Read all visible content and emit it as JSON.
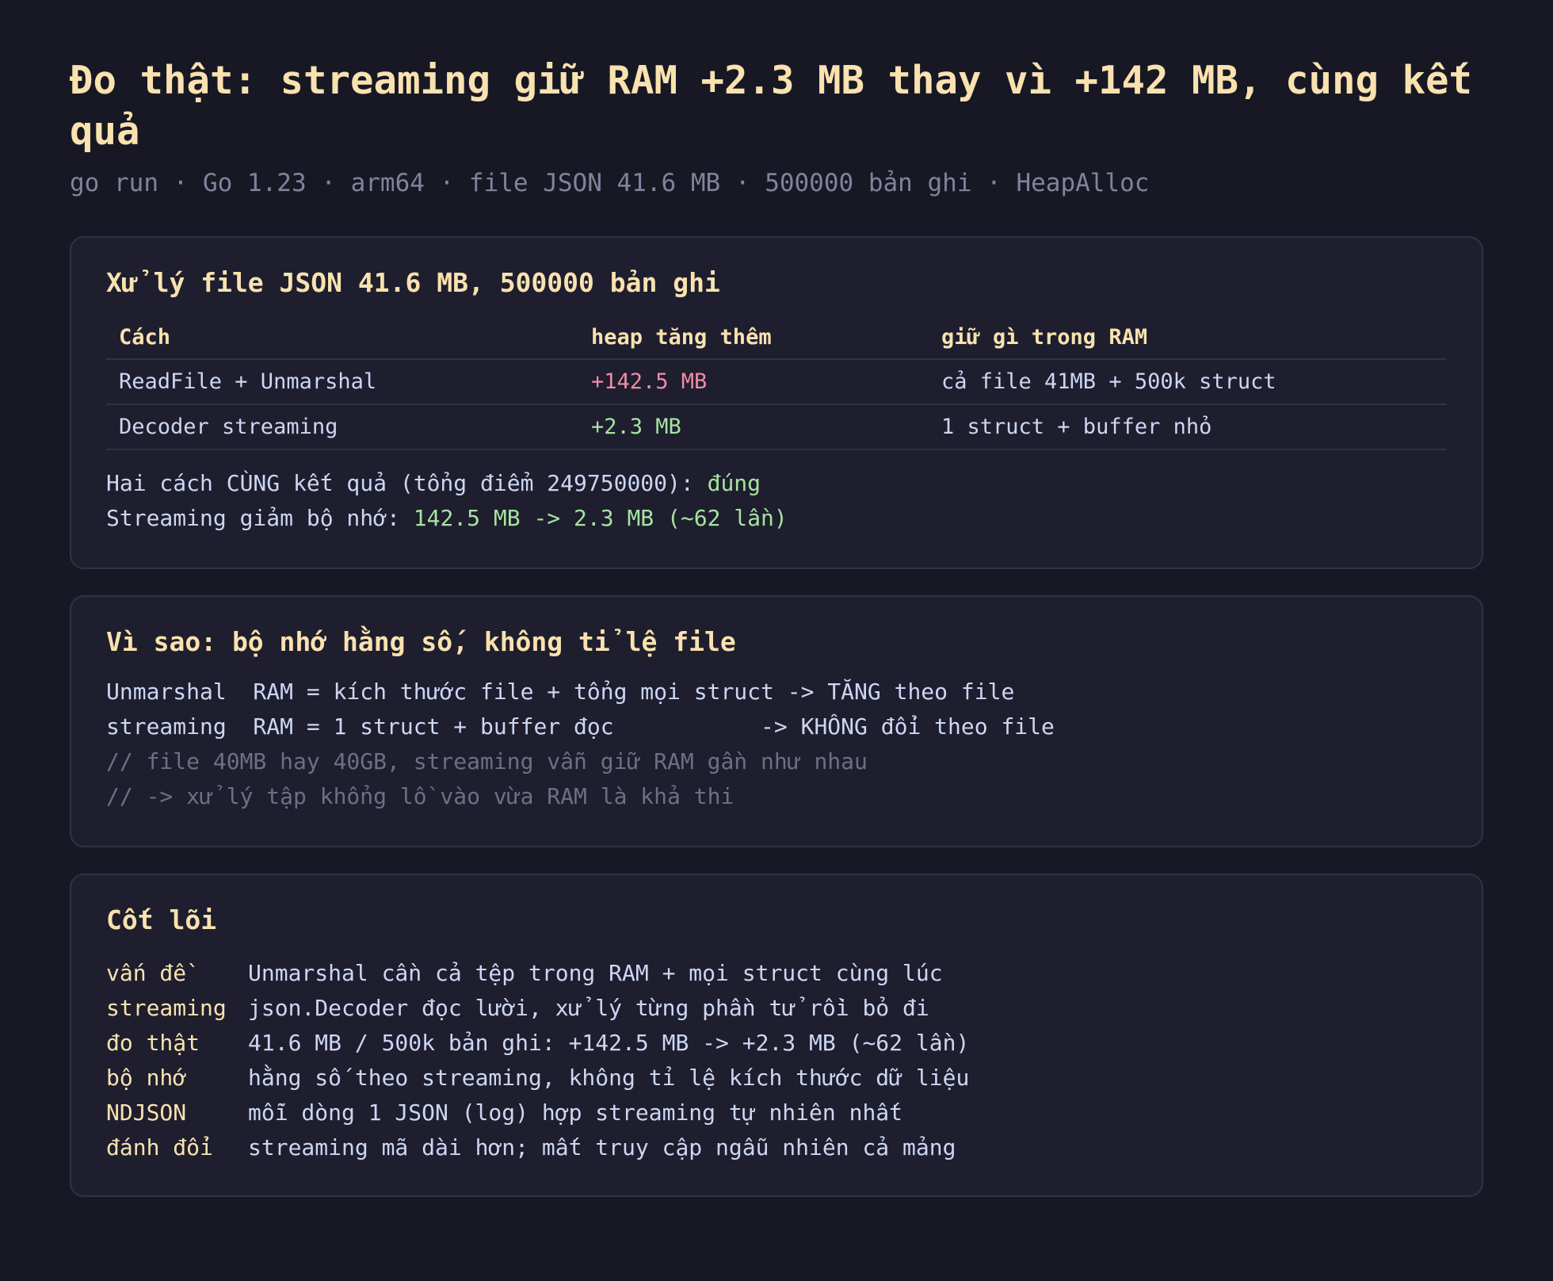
{
  "header": {
    "title": "Đo thật: streaming giữ RAM +2.3 MB thay vì +142 MB, cùng kết quả",
    "subtitle": "go run · Go 1.23 · arm64 · file JSON 41.6 MB · 500000 bản ghi · HeapAlloc"
  },
  "measure": {
    "title": "Xử lý file JSON 41.6 MB, 500000 bản ghi",
    "columns": [
      "Cách",
      "heap tăng thêm",
      "giữ gì trong RAM"
    ],
    "rows": [
      {
        "method": "ReadFile + Unmarshal",
        "heap": "+142.5 MB",
        "holds": "cả file 41MB + 500k struct"
      },
      {
        "method": "Decoder streaming",
        "heap": "+2.3 MB",
        "holds": "1 struct + buffer nhỏ"
      }
    ],
    "same_result_label": "Hai cách CÙNG kết quả (tổng điểm 249750000): ",
    "same_result_value": "đúng",
    "reduction_label": "Streaming giảm bộ nhớ: ",
    "reduction_value": "142.5 MB -> 2.3 MB (~62 lần)"
  },
  "why": {
    "title": "Vì sao: bộ nhớ hằng số, không tỉ lệ file",
    "lines": [
      "Unmarshal  RAM = kích thước file + tổng mọi struct -> TĂNG theo file",
      "streaming  RAM = 1 struct + buffer đọc           -> KHÔNG đổi theo file"
    ],
    "comments": [
      "// file 40MB hay 40GB, streaming vẫn giữ RAM gần như nhau",
      "// -> xử lý tập khổng lồ vào vừa RAM là khả thi"
    ]
  },
  "core": {
    "title": "Cốt lõi",
    "items": [
      {
        "key": "vấn đề",
        "value": "Unmarshal cần cả tệp trong RAM + mọi struct cùng lúc"
      },
      {
        "key": "streaming",
        "value": "json.Decoder đọc lười, xử lý từng phần tử rồi bỏ đi"
      },
      {
        "key": "đo thật",
        "value": "41.6 MB / 500k bản ghi: +142.5 MB -> +2.3 MB (~62 lần)"
      },
      {
        "key": "bộ nhớ",
        "value": "hằng số theo streaming, không tỉ lệ kích thước dữ liệu"
      },
      {
        "key": "NDJSON",
        "value": "mỗi dòng 1 JSON (log) hợp streaming tự nhiên nhất"
      },
      {
        "key": "đánh đổi",
        "value": "streaming mã dài hơn; mất truy cập ngẫu nhiên cả mảng"
      }
    ]
  },
  "colors": {
    "background": "#181825",
    "card": "#1e1e2e",
    "accent": "#f9e2af",
    "bad": "#f38ba8",
    "good": "#a6e3a1",
    "muted": "#7f849c"
  }
}
